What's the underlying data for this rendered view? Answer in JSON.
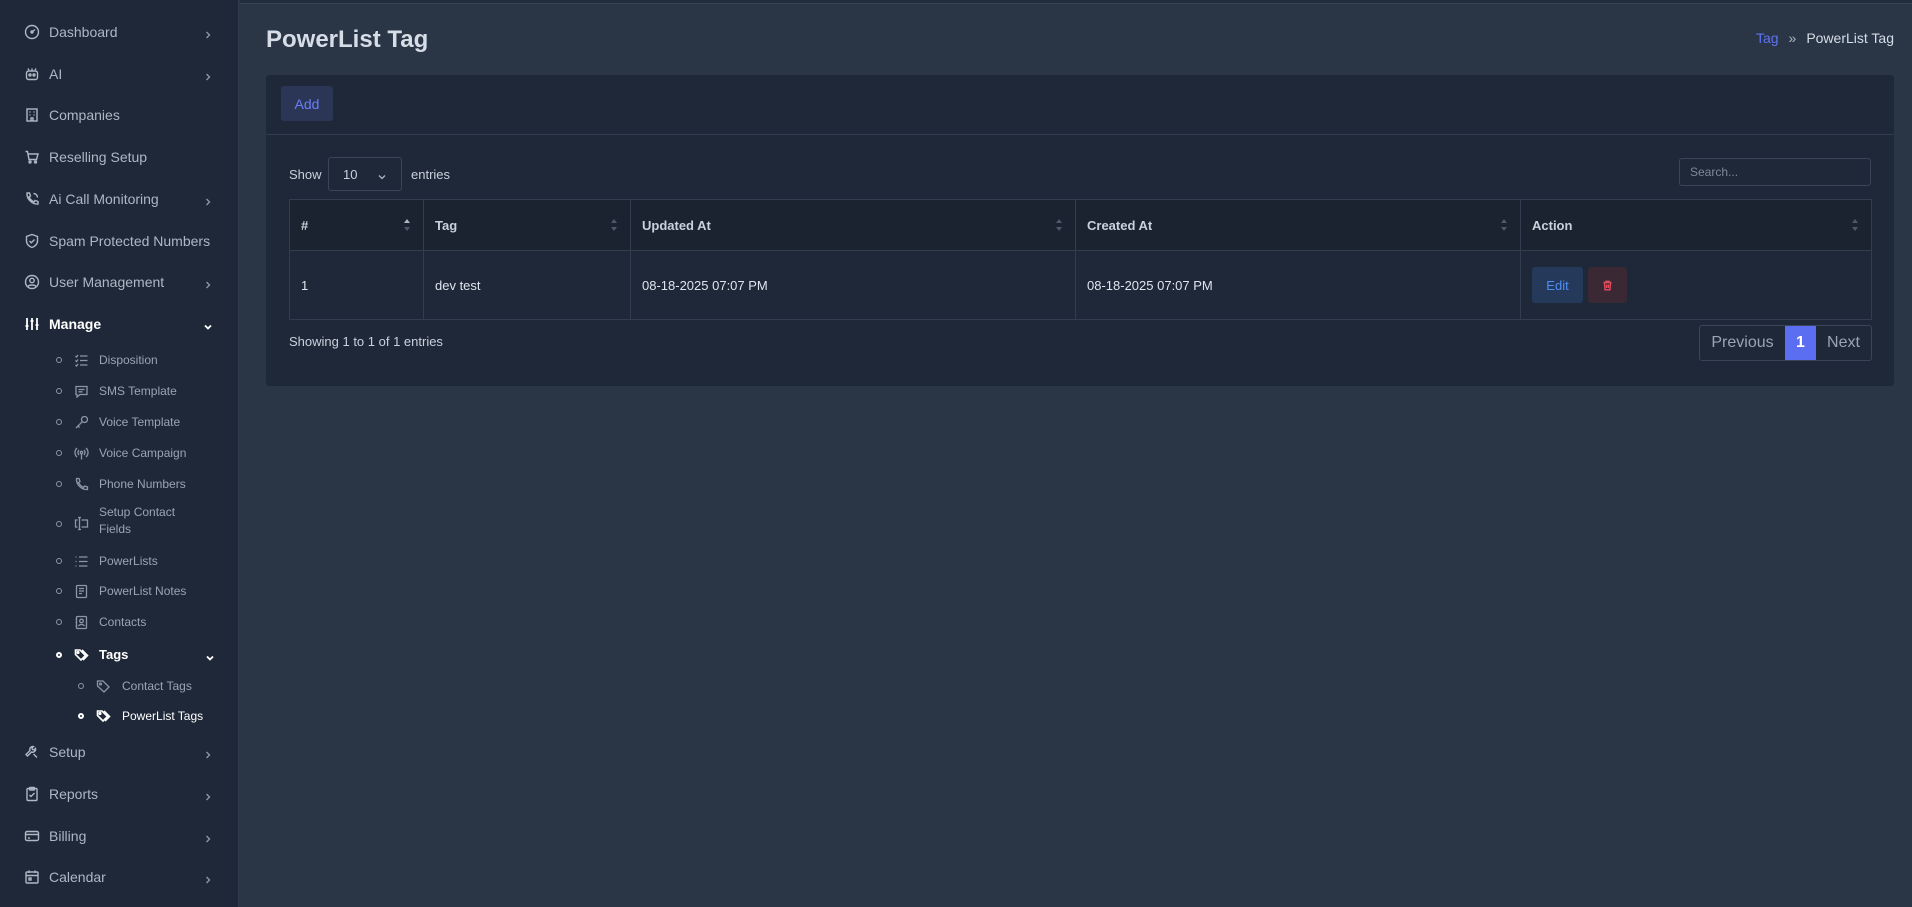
{
  "sidebar": {
    "items": [
      {
        "label": "Dashboard",
        "icon": "gauge-icon"
      },
      {
        "label": "AI",
        "icon": "robot-icon"
      },
      {
        "label": "Companies",
        "icon": "building-icon"
      },
      {
        "label": "Reselling Setup",
        "icon": "cart-icon"
      },
      {
        "label": "Ai Call Monitoring",
        "icon": "phone-call-icon"
      },
      {
        "label": "Spam Protected Numbers",
        "icon": "shield-icon"
      },
      {
        "label": "User Management",
        "icon": "user-circle-icon"
      },
      {
        "label": "Manage",
        "icon": "sliders-icon"
      },
      {
        "label": "Setup",
        "icon": "tools-icon"
      },
      {
        "label": "Reports",
        "icon": "clipboard-icon"
      },
      {
        "label": "Billing",
        "icon": "card-icon"
      },
      {
        "label": "Calendar",
        "icon": "calendar-icon"
      }
    ],
    "manage_sub": [
      {
        "label": "Disposition",
        "icon": "list-check-icon"
      },
      {
        "label": "SMS Template",
        "icon": "message-icon"
      },
      {
        "label": "Voice Template",
        "icon": "key-icon"
      },
      {
        "label": "Voice Campaign",
        "icon": "broadcast-icon"
      },
      {
        "label": "Phone Numbers",
        "icon": "phone-icon"
      },
      {
        "label": "Setup Contact",
        "label2": "Fields",
        "icon": "input-field-icon"
      },
      {
        "label": "PowerLists",
        "icon": "list-icon"
      },
      {
        "label": "PowerList Notes",
        "icon": "notes-icon"
      },
      {
        "label": "Contacts",
        "icon": "contacts-icon"
      },
      {
        "label": "Tags",
        "icon": "tags-icon"
      }
    ],
    "tags_sub": [
      {
        "label": "Contact Tags",
        "icon": "tag-icon"
      },
      {
        "label": "PowerList Tags",
        "icon": "tags-icon"
      }
    ]
  },
  "header": {
    "title": "PowerList Tag",
    "breadcrumb": {
      "link": "Tag",
      "separator": "»",
      "current": "PowerList Tag"
    }
  },
  "toolbar": {
    "add_label": "Add"
  },
  "table_controls": {
    "show_label": "Show",
    "entries_label": "entries",
    "page_length": "10",
    "search_placeholder": "Search..."
  },
  "table": {
    "columns": [
      "#",
      "Tag",
      "Updated At",
      "Created At",
      "Action"
    ],
    "rows": [
      {
        "num": "1",
        "tag": "dev test",
        "updated_at": "08-18-2025 07:07 PM",
        "created_at": "08-18-2025 07:07 PM",
        "edit_label": "Edit"
      }
    ]
  },
  "footer": {
    "info": "Showing 1 to 1 of 1 entries",
    "prev_label": "Previous",
    "page": "1",
    "next_label": "Next"
  },
  "colors": {
    "accent": "#5b6df1",
    "link": "#5f74f3",
    "danger": "#e24d5e",
    "sidebar_bg": "#1f2838",
    "page_bg": "#2a3546"
  }
}
